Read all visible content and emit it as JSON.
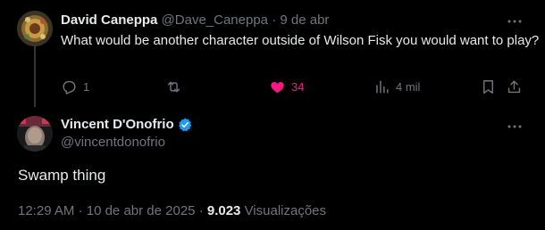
{
  "reply_tweet": {
    "author_name": "David Caneppa",
    "handle": "@Dave_Caneppa",
    "separator": "·",
    "date": "9 de abr",
    "text": "What would be another character outside of Wilson Fisk you would want to play?",
    "actions": {
      "replies": "1",
      "retweets": "",
      "likes": "34",
      "views": "4 mil"
    },
    "icons": [
      "more-icon",
      "reply-icon",
      "retweet-icon",
      "heart-icon",
      "views-icon",
      "bookmark-icon",
      "share-icon"
    ]
  },
  "main_tweet": {
    "author_name": "Vincent D'Onofrio",
    "handle": "@vincentdonofrio",
    "verified": true,
    "text": "Swamp thing",
    "time": "12:29 AM",
    "separator": "·",
    "date": "10 de abr de 2025",
    "separator2": "·",
    "views_count": "9.023",
    "views_label": "Visualizações"
  },
  "colors": {
    "background": "#000000",
    "text": "#e7e9ea",
    "muted": "#71767b",
    "like": "#f91880",
    "verified": "#1d9bf0"
  }
}
